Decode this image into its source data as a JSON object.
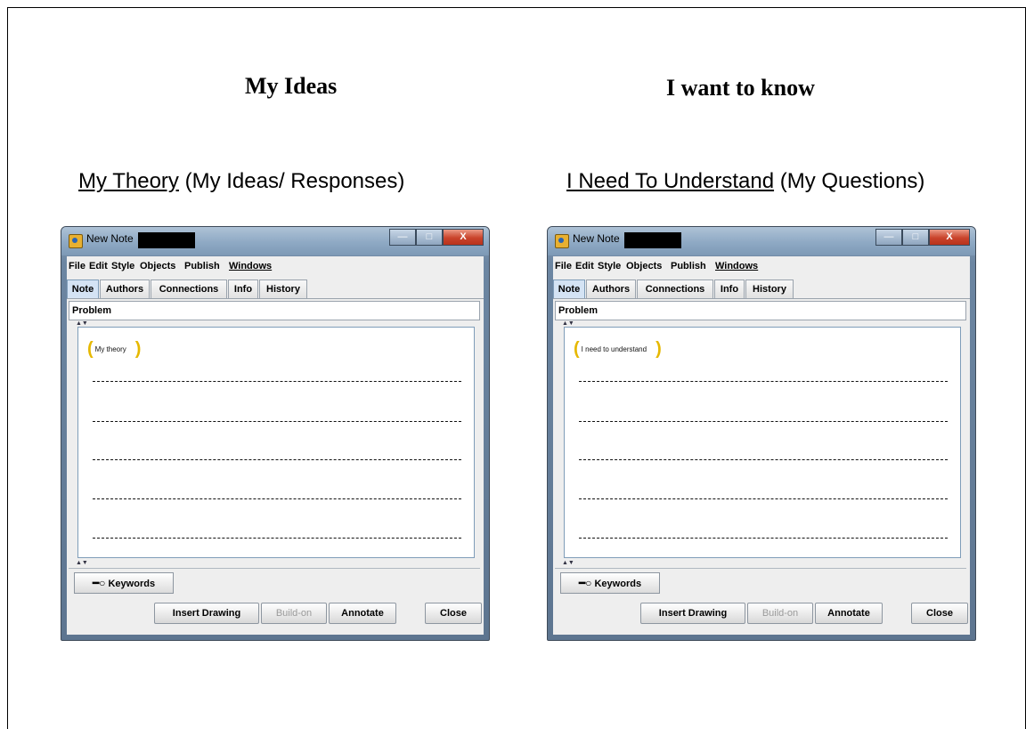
{
  "headings": {
    "left": "My Ideas",
    "right": "I want to know"
  },
  "subheadings": {
    "left": {
      "underlined": "My Theory",
      "rest": " (My Ideas/ Responses)"
    },
    "right": {
      "underlined": "I Need To Understand",
      "rest": " (My Questions)"
    }
  },
  "windows": [
    {
      "title": "New Note",
      "menu": [
        "File",
        "Edit",
        "Style",
        "Objects",
        "Publish",
        "Windows"
      ],
      "tabs": [
        "Note",
        "Authors",
        "Connections",
        "Info",
        "History"
      ],
      "problem_label": "Problem",
      "scaffold_label": "My theory",
      "keywords_label": "Keywords",
      "buttons": {
        "insert_drawing": "Insert Drawing",
        "build_on": "Build-on",
        "annotate": "Annotate",
        "close": "Close"
      }
    },
    {
      "title": "New Note",
      "menu": [
        "File",
        "Edit",
        "Style",
        "Objects",
        "Publish",
        "Windows"
      ],
      "tabs": [
        "Note",
        "Authors",
        "Connections",
        "Info",
        "History"
      ],
      "problem_label": "Problem",
      "scaffold_label": "I need to understand",
      "keywords_label": "Keywords",
      "buttons": {
        "insert_drawing": "Insert Drawing",
        "build_on": "Build-on",
        "annotate": "Annotate",
        "close": "Close"
      }
    }
  ],
  "icons": {
    "app": "java-cup-icon",
    "key": "key-icon",
    "minimize": "minimize-icon",
    "maximize": "maximize-icon",
    "close": "close-icon"
  },
  "colors": {
    "scaffold_brace": "#e6b800",
    "active_tab": "#d4e3f4",
    "close_button": "#c9432b"
  }
}
